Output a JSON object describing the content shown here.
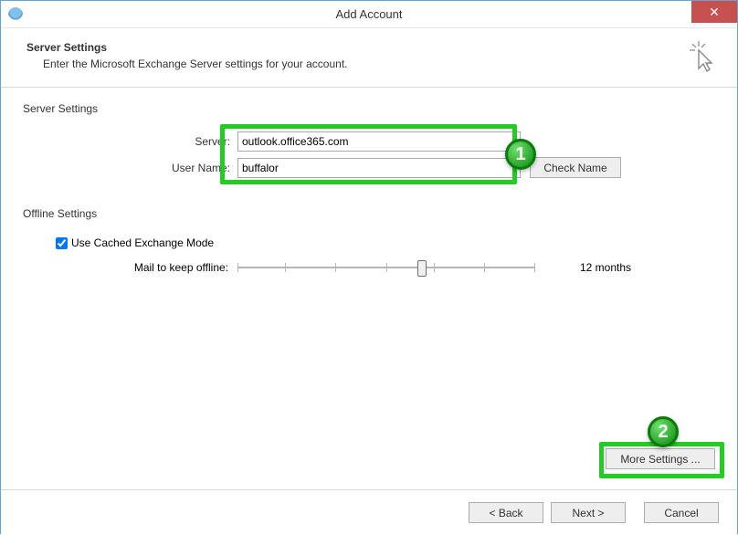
{
  "window": {
    "title": "Add Account"
  },
  "header": {
    "title": "Server Settings",
    "subtitle": "Enter the Microsoft Exchange Server settings for your account."
  },
  "serverSettings": {
    "section_label": "Server Settings",
    "server_label": "Server:",
    "server_value": "outlook.office365.com",
    "user_label": "User Name:",
    "user_value": "buffalor",
    "checkname_label": "Check Name"
  },
  "offlineSettings": {
    "section_label": "Offline Settings",
    "cached_label": "Use Cached Exchange Mode",
    "cached_checked": true,
    "mail_keep_label": "Mail to keep offline:",
    "slider_value_label": "12 months"
  },
  "more_settings_label": "More Settings ...",
  "footer": {
    "back": "<  Back",
    "next": "Next  >",
    "cancel": "Cancel"
  },
  "annotations": {
    "badge1": "1",
    "badge2": "2"
  }
}
